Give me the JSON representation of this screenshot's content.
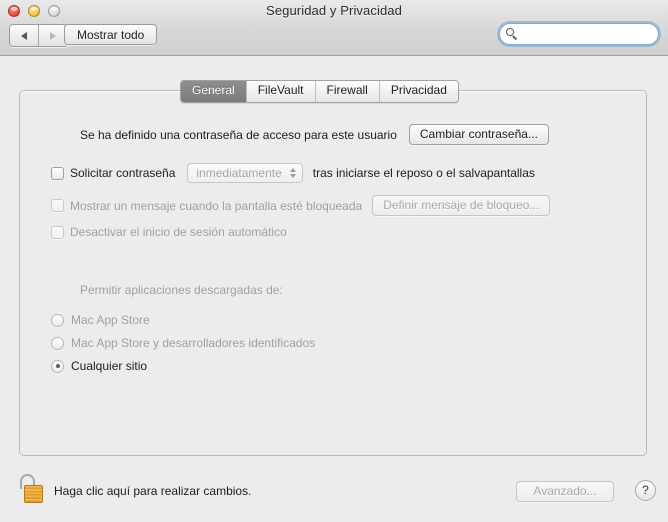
{
  "window": {
    "title": "Seguridad y Privacidad",
    "traffic_lights": {
      "close": "close-button",
      "minimize": "minimize-button",
      "zoom": "zoom-button"
    }
  },
  "toolbar": {
    "back_label": "◀",
    "forward_label": "▶",
    "show_all_label": "Mostrar todo",
    "search": {
      "value": "",
      "placeholder": ""
    }
  },
  "tabs": [
    {
      "label": "General",
      "selected": true
    },
    {
      "label": "FileVault",
      "selected": false
    },
    {
      "label": "Firewall",
      "selected": false
    },
    {
      "label": "Privacidad",
      "selected": false
    }
  ],
  "main": {
    "password_set_text": "Se ha definido una contraseña de acceso para este usuario",
    "change_password_button": "Cambiar contraseña...",
    "require_password": {
      "label": "Solicitar contraseña",
      "checked": false,
      "enabled": true,
      "delay_value": "inmediatamente",
      "suffix": "tras iniciarse el reposo o el salvapantallas"
    },
    "show_message": {
      "label": "Mostrar un mensaje cuando la pantalla esté bloqueada",
      "checked": false,
      "enabled": false,
      "button": "Definir mensaje de bloqueo..."
    },
    "disable_auto_login": {
      "label": "Desactivar el inicio de sesión automático",
      "checked": false,
      "enabled": false
    },
    "allow_apps_heading": "Permitir aplicaciones descargadas de:",
    "allow_apps_options": [
      {
        "label": "Mac App Store",
        "selected": false
      },
      {
        "label": "Mac App Store y desarrolladores identificados",
        "selected": false
      },
      {
        "label": "Cualquier sitio",
        "selected": true
      }
    ]
  },
  "bottom": {
    "lock_state": "unlocked",
    "lock_text": "Haga clic aquí para realizar cambios.",
    "advanced_button": "Avanzado...",
    "help_button": "?"
  },
  "colors": {
    "window_bg": "#ececec",
    "titlebar_top": "#e9e9e9",
    "titlebar_bottom": "#cfcfcf",
    "selected_tab": "#7c7c7c",
    "lock_gold": "#e09c2d",
    "search_focus_ring": "#6ea0dc"
  }
}
